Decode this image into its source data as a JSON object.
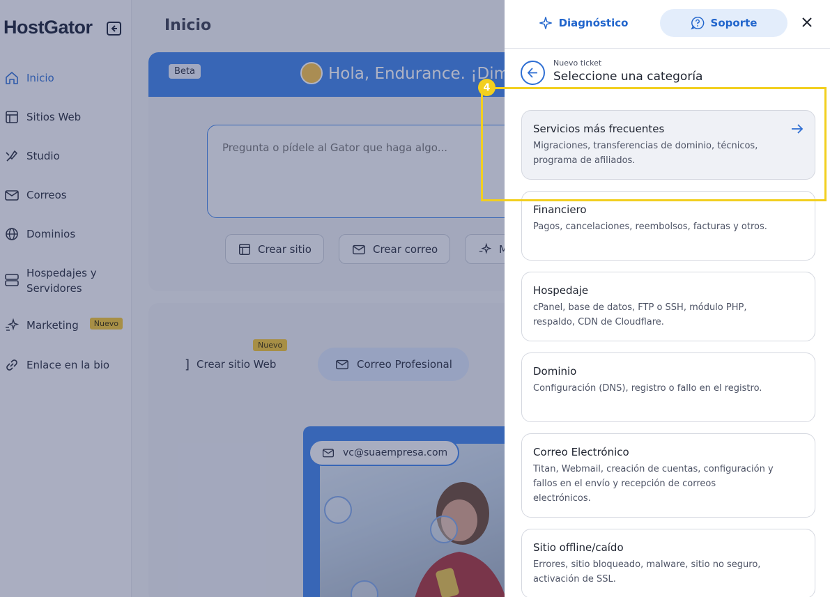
{
  "sidebar": {
    "logo": "HostGator",
    "items": [
      {
        "label": "Inicio"
      },
      {
        "label": "Sitios Web"
      },
      {
        "label": "Studio"
      },
      {
        "label": "Correos"
      },
      {
        "label": "Dominios"
      },
      {
        "label": "Hospedajes y Servidores"
      },
      {
        "label": "Marketing",
        "badge": "Nuevo"
      },
      {
        "label": "Enlace en la bio"
      }
    ]
  },
  "main": {
    "title": "Inicio",
    "hero": {
      "badge": "Beta",
      "greeting": "Hola, Endurance. ¡Dim",
      "prompt_placeholder": "Pregunta o pídele al Gator que haga algo...",
      "chips": [
        "Crear sitio",
        "Crear correo",
        "M"
      ]
    },
    "tabs": {
      "badge": "Nuevo",
      "items": [
        "Crear sitio Web",
        "Correo Profesional"
      ]
    },
    "preview": {
      "email": "vc@suaempresa.com"
    }
  },
  "panel": {
    "tabs": [
      "Diagnóstico",
      "Soporte"
    ],
    "breadcrumb": "Nuevo ticket",
    "title": "Seleccione una categoría",
    "step": "4",
    "categories": [
      {
        "title": "Servicios más frecuentes",
        "desc": "Migraciones, transferencias de dominio, técnicos, programa de afiliados."
      },
      {
        "title": "Financiero",
        "desc": "Pagos, cancelaciones, reembolsos, facturas y otros."
      },
      {
        "title": "Hospedaje",
        "desc": "cPanel, base de datos, FTP o SSH, módulo PHP, respaldo, CDN de Cloudflare."
      },
      {
        "title": "Dominio",
        "desc": "Configuración (DNS), registro o fallo en el registro."
      },
      {
        "title": "Correo Electrónico",
        "desc": "Titan, Webmail, creación de cuentas, configuración y fallos en el envío y recepción de correos electrónicos."
      },
      {
        "title": "Sitio offline/caído",
        "desc": "Errores, sitio bloqueado, malware, sitio no seguro, activación de SSL."
      }
    ]
  },
  "colors": {
    "accent": "#2f6fd3",
    "highlight": "#f2cf1f",
    "badge": "#f2c634"
  }
}
